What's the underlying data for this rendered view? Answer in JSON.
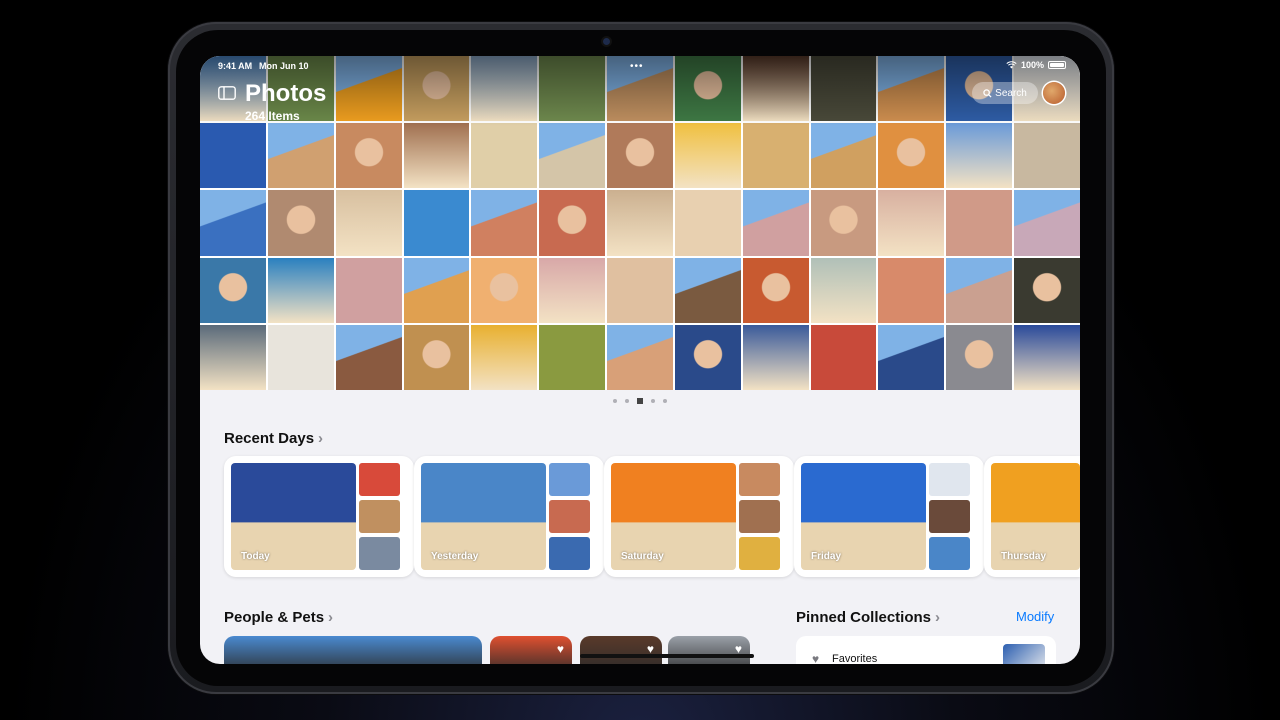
{
  "status_bar": {
    "time": "9:41 AM",
    "date": "Mon Jun 10",
    "battery": "100%"
  },
  "header": {
    "title": "Photos",
    "subtitle": "264 Items",
    "search_label": "Search"
  },
  "grid_colors": [
    [
      "#4a86c8",
      "#6c8a4a",
      "#f0a020",
      "#c8a060",
      "#8aa8c8",
      "#6f8a4e",
      "#c09060",
      "#3f7a45",
      "#5a3a2a",
      "#4a4a3a",
      "#d09050",
      "#2f5ea8",
      "#e0e6ee"
    ],
    [
      "#2a5ab0",
      "#d0a070",
      "#c88a60",
      "#a07050",
      "#e0cfa8",
      "#d4c5a8",
      "#b07a5a",
      "#f0c040",
      "#d8b070",
      "#d0a060",
      "#e09040",
      "#6a9ad8",
      "#c8b8a0"
    ],
    [
      "#3a70c0",
      "#b08a70",
      "#d8c0a0",
      "#3a8ad0",
      "#d08060",
      "#c86a50",
      "#cbb090",
      "#e8d0b0",
      "#d0a0a0",
      "#c89a80",
      "#d8b0a0",
      "#d09a88",
      "#c8a8b8"
    ],
    [
      "#3a78a8",
      "#2a80c0",
      "#d0a0a0",
      "#e0a050",
      "#f0b070",
      "#d8a8a8",
      "#e0c0a0",
      "#7a5a40",
      "#c85a30",
      "#b0c0b8",
      "#d88a6a",
      "#caa090",
      "#3a3a30"
    ],
    [
      "#5a6a7a",
      "#e8e4dc",
      "#8a5a40",
      "#c09050",
      "#e8b030",
      "#8a9a40",
      "#d8a078",
      "#2a4a8a",
      "#3a5a9a",
      "#c84a3a",
      "#2a4a8a",
      "#8a8a90",
      "#2a4a9a"
    ]
  ],
  "pager": {
    "dots": [
      "dot",
      "dot",
      "grid",
      "dot",
      "dot"
    ]
  },
  "recent_days": {
    "heading": "Recent Days",
    "days": [
      {
        "label": "Today",
        "main_color": "#2a4a9a",
        "thumbs": [
          "#d84a3a",
          "#c09060",
          "#7a8aa0"
        ]
      },
      {
        "label": "Yesterday",
        "main_color": "#4a86c8",
        "thumbs": [
          "#6a9ad8",
          "#c86a50",
          "#3a6ab0"
        ]
      },
      {
        "label": "Saturday",
        "main_color": "#f08020",
        "thumbs": [
          "#c88a60",
          "#a07050",
          "#e0b040"
        ]
      },
      {
        "label": "Friday",
        "main_color": "#2a6ad0",
        "thumbs": [
          "#e0e6ee",
          "#6a4a3a",
          "#4a86c8"
        ]
      },
      {
        "label": "Thursday",
        "main_color": "#f0a020",
        "thumbs": []
      }
    ]
  },
  "people_pets": {
    "heading": "People & Pets",
    "cards": [
      {
        "color": "#4a8ad0",
        "favorite": false
      },
      {
        "color": "#e05030",
        "favorite": true
      },
      {
        "color": "#5a3a2a",
        "favorite": true
      },
      {
        "color": "#9aa0a8",
        "favorite": true
      }
    ]
  },
  "pinned": {
    "heading": "Pinned Collections",
    "modify_label": "Modify",
    "favorites_label": "Favorites"
  },
  "icons": {
    "sidebar": "sidebar-icon",
    "search": "magnifier",
    "heart": "heart",
    "chevron": "chevron-right"
  }
}
